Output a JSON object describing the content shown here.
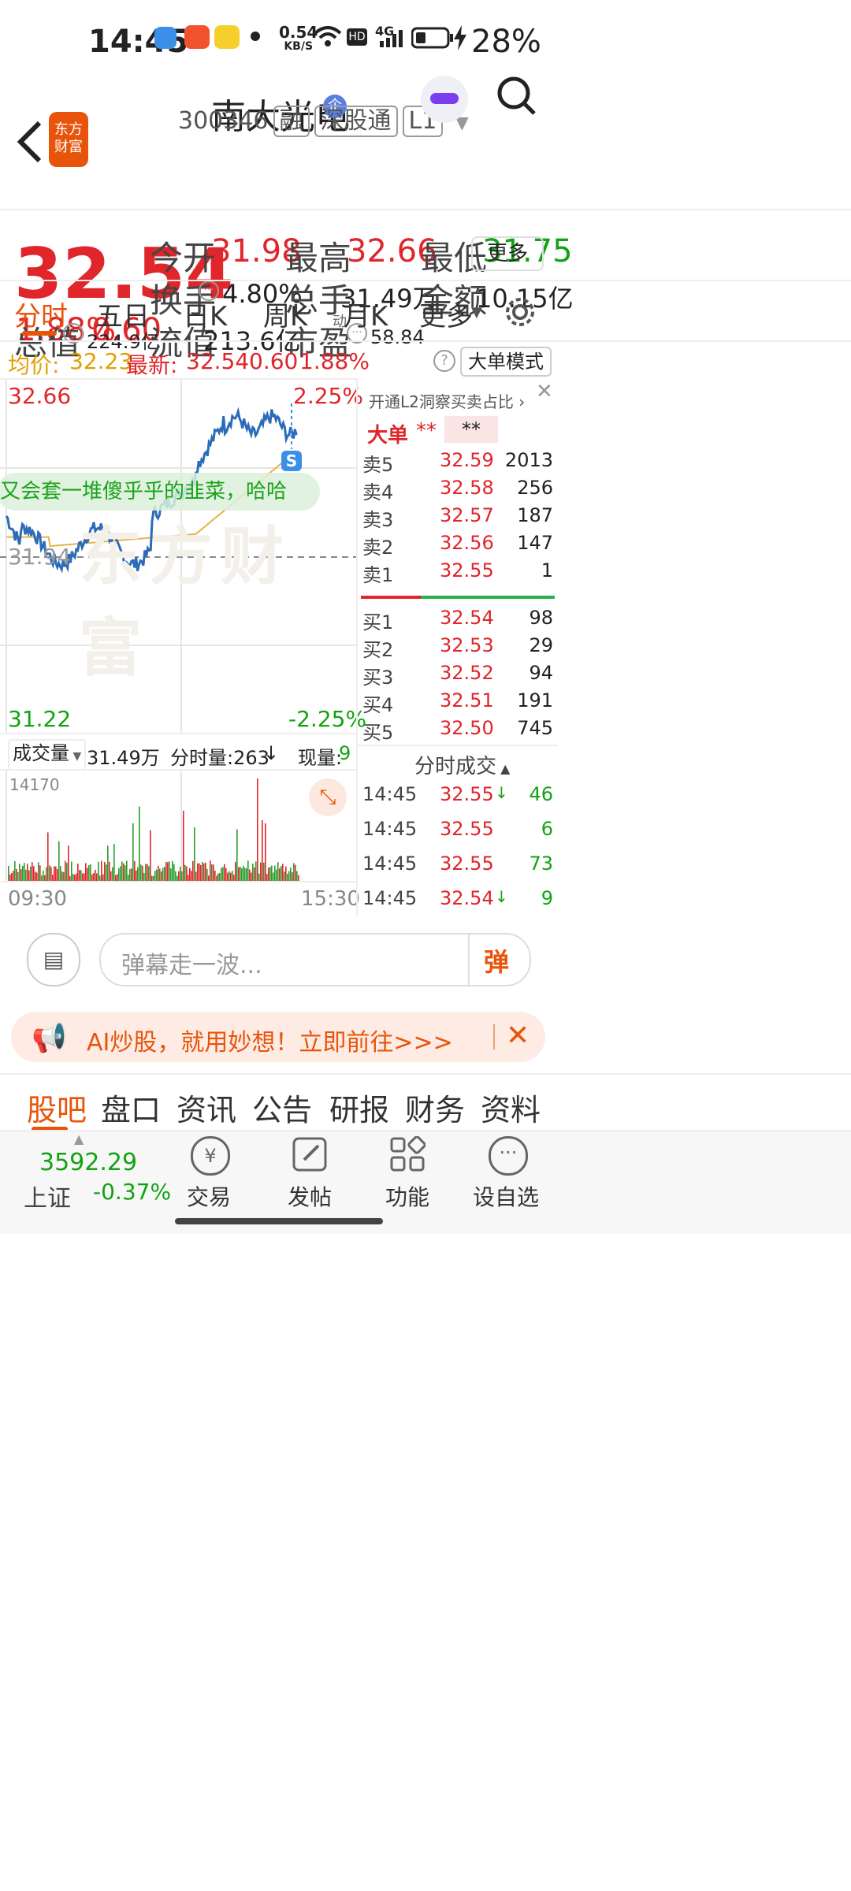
{
  "status_bar": {
    "time": "14:45",
    "net_speed_value": "0.54",
    "net_speed_unit": "KB/S",
    "network": "4G",
    "battery": "28%"
  },
  "header": {
    "back_icon": "chevron-left-icon",
    "app_logo_line1": "东方",
    "app_logo_line2": "财富",
    "stock_name": "南大光电",
    "company_badge": "企",
    "stock_code": "300346",
    "tags": [
      "融",
      "深股通",
      "L1"
    ],
    "search_icon": "search-icon"
  },
  "quote": {
    "price": "32.54",
    "change_pct": "1.88%",
    "change_amt": "0.60",
    "open_label": "今开",
    "open": "31.98",
    "high_label": "最高",
    "high": "32.66",
    "low_label": "最低",
    "low": "31.75",
    "turnover_label": "换手",
    "turnover": "4.80%",
    "volume_label": "总手",
    "volume": "31.49万",
    "amount_label": "金额",
    "amount": "10.15亿",
    "mktcap_label": "总值",
    "mktcap": "224.9亿",
    "float_label": "流值",
    "float": "213.6亿",
    "pe_label": "市盈",
    "pe_sup": "动",
    "pe": "58.84",
    "more_button": "更多"
  },
  "chart_tabs": [
    "分时",
    "五日",
    "日K",
    "周K",
    "月K",
    "更多"
  ],
  "chart_header": {
    "avg_label": "均价:",
    "avg": "32.23",
    "latest_label": "最新:",
    "latest": "32.54",
    "latest_change": "0.60",
    "latest_pct": "1.88%",
    "mode_button": "大单模式"
  },
  "chart": {
    "high_price": "32.66",
    "low_price": "31.22",
    "mid_price": "31.94",
    "high_pct": "2.25%",
    "low_pct": "-2.25%",
    "watermark": "东方财富",
    "s_marker": "S",
    "danmaku_text": "又会套一堆傻乎乎的韭菜，哈哈"
  },
  "volume_header": {
    "label": "成交量",
    "total": "31.49万",
    "min_label": "分时量:263",
    "arrow": "↓",
    "now_label": "现量:",
    "now_val": "9",
    "max": "14170",
    "start_time": "09:30",
    "end_time": "15:30"
  },
  "order_book": {
    "promo": "开通L2洞察买卖占比",
    "big_order_label": "大单",
    "big_order_v1": "**",
    "big_order_v2": "**",
    "asks": [
      {
        "label": "卖5",
        "price": "32.59",
        "vol": "2013"
      },
      {
        "label": "卖4",
        "price": "32.58",
        "vol": "256"
      },
      {
        "label": "卖3",
        "price": "32.57",
        "vol": "187"
      },
      {
        "label": "卖2",
        "price": "32.56",
        "vol": "147"
      },
      {
        "label": "卖1",
        "price": "32.55",
        "vol": "1"
      }
    ],
    "bids": [
      {
        "label": "买1",
        "price": "32.54",
        "vol": "98"
      },
      {
        "label": "买2",
        "price": "32.53",
        "vol": "29"
      },
      {
        "label": "买3",
        "price": "32.52",
        "vol": "94"
      },
      {
        "label": "买4",
        "price": "32.51",
        "vol": "191"
      },
      {
        "label": "买5",
        "price": "32.50",
        "vol": "745"
      }
    ],
    "ticks_title": "分时成交",
    "ticks": [
      {
        "time": "14:45",
        "price": "32.55",
        "arrow": "↓",
        "vol": "46"
      },
      {
        "time": "14:45",
        "price": "32.55",
        "arrow": "",
        "vol": "6"
      },
      {
        "time": "14:45",
        "price": "32.55",
        "arrow": "",
        "vol": "73"
      },
      {
        "time": "14:45",
        "price": "32.54",
        "arrow": "↓",
        "vol": "9"
      }
    ]
  },
  "danmaku_bar": {
    "placeholder": "弹幕走一波...",
    "send_label": "弹"
  },
  "ad_banner": {
    "text": "AI炒股，就用妙想！立即前往>>>"
  },
  "bottom_nav": [
    "股吧",
    "盘口",
    "资讯",
    "公告",
    "研报",
    "财务",
    "资料"
  ],
  "dock": {
    "index_value": "3592.29",
    "index_name": "上证",
    "index_change": "-0.37%",
    "items": [
      {
        "label": "交易",
        "icon": "yen-exchange-icon"
      },
      {
        "label": "发帖",
        "icon": "edit-icon"
      },
      {
        "label": "功能",
        "icon": "grid-icon"
      },
      {
        "label": "设自选",
        "icon": "more-dots-icon"
      }
    ]
  },
  "colors": {
    "up": "#e0252b",
    "down": "#12a312",
    "accent": "#e8540a",
    "price_line": "#2b6bb8",
    "avg_line": "#e6b24a"
  }
}
